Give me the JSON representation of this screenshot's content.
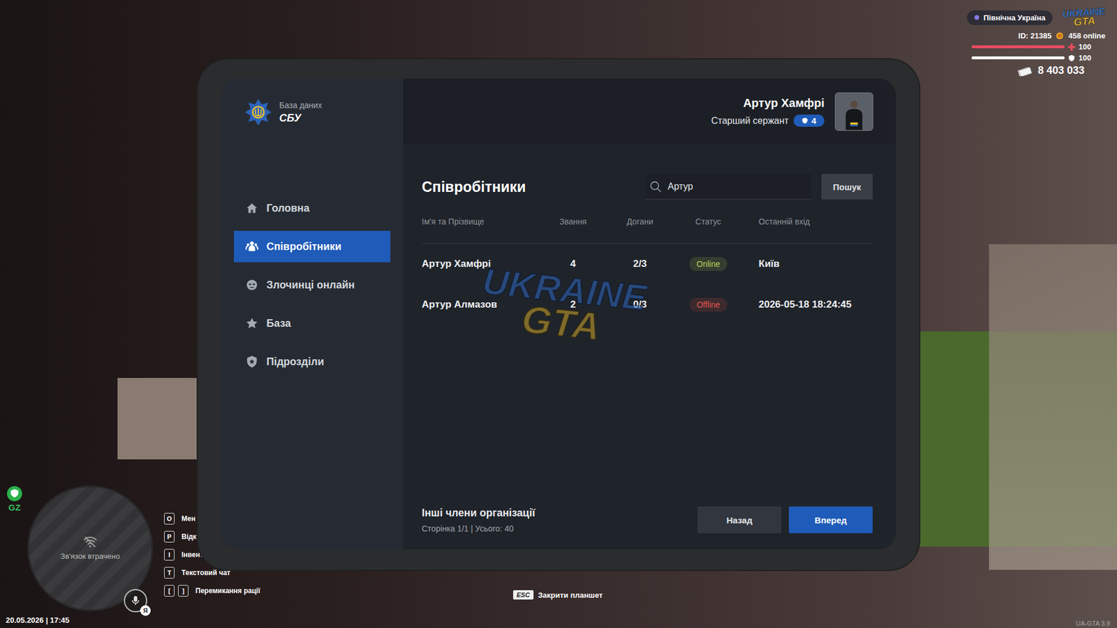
{
  "hud": {
    "region": "Північна Україна",
    "logo": {
      "top": "UKRAINE",
      "bottom": "GTA"
    },
    "id": "ID: 21385",
    "online": "458 online",
    "health": {
      "level": 1,
      "reading": "100"
    },
    "armor": {
      "level": 1,
      "reading": "100"
    },
    "money": "8 403 033",
    "zone": "GZ",
    "minimap": "Зв'язок втрачено",
    "mic_badge": "Я",
    "datetime": "20.05.2026 | 17:45",
    "hints": [
      {
        "keys": [
          "O"
        ],
        "label": "Мен"
      },
      {
        "keys": [
          "P"
        ],
        "label": "Відк"
      },
      {
        "keys": [
          "I"
        ],
        "label": "Інвент"
      },
      {
        "keys": [
          "T"
        ],
        "label": "Текстовий чат"
      },
      {
        "keys": [
          "[",
          "]"
        ],
        "label": "Перемикання рації"
      }
    ],
    "close_hint": {
      "key": "ESC",
      "label": "Закрити планшет"
    },
    "version": "UA-GTA 3.9"
  },
  "tablet": {
    "brand": {
      "subtitle": "База даних",
      "title": "СБУ"
    },
    "user": {
      "name": "Артур Хамфрі",
      "rank": "Старший сержант",
      "rank_level": "4"
    },
    "sidebar": {
      "items": [
        {
          "label": "Головна",
          "selected": false
        },
        {
          "label": "Співробітники",
          "selected": true
        },
        {
          "label": "Злочинці онлайн",
          "selected": false
        },
        {
          "label": "База",
          "selected": false
        },
        {
          "label": "Підрозділи",
          "selected": false
        }
      ]
    },
    "page_title": "Співробітники",
    "search": {
      "value": "Артур",
      "button": "Пошук"
    },
    "table": {
      "columns": [
        "Ім'я та Прізвище",
        "Звання",
        "Догани",
        "Статус",
        "Останній вхід"
      ],
      "rows": [
        {
          "name": "Артур Хамфрі",
          "rank": "4",
          "reprimands": "2/3",
          "status": "Online",
          "color": "#b9d65c",
          "last_login": "Київ"
        },
        {
          "name": "Артур Алмазов",
          "rank": "2",
          "reprimands": "0/3",
          "status": "Offline",
          "color": "#e5574d",
          "last_login": "2026-05-18 18:24:45"
        }
      ]
    },
    "footer": {
      "title": "Інші члени організації",
      "page_info": "Сторінка 1/1 | Усього: 40",
      "buttons": [
        {
          "label": "Назад",
          "primary": false
        },
        {
          "label": "Вперед",
          "primary": true
        }
      ]
    },
    "watermark": {
      "top": "UKRAINE",
      "bottom": "GTA"
    }
  }
}
